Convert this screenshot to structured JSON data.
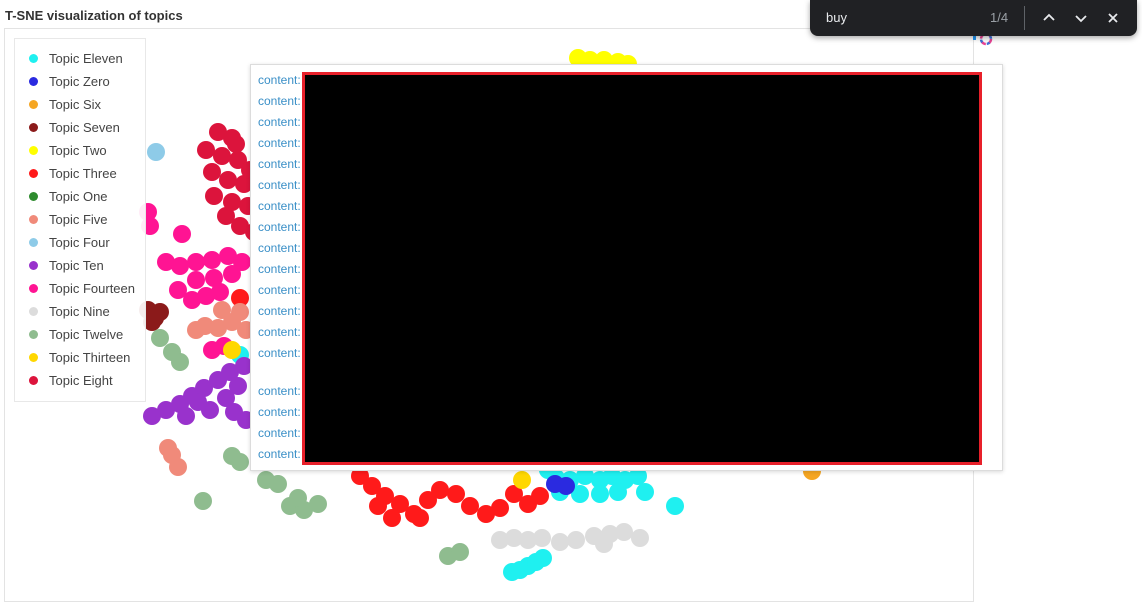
{
  "chart_data": {
    "type": "scatter",
    "title": "T-SNE visualization of topics",
    "legend_position": "top-left",
    "series": [
      {
        "name": "Topic Eleven",
        "color": "#1ff0f0",
        "points": [
          [
            512,
            572
          ],
          [
            520,
            570
          ],
          [
            528,
            566
          ],
          [
            536,
            562
          ],
          [
            543,
            558
          ],
          [
            548,
            470
          ],
          [
            556,
            478
          ],
          [
            570,
            480
          ],
          [
            585,
            476
          ],
          [
            600,
            480
          ],
          [
            612,
            476
          ],
          [
            625,
            480
          ],
          [
            638,
            476
          ],
          [
            645,
            492
          ],
          [
            618,
            492
          ],
          [
            600,
            494
          ],
          [
            580,
            494
          ],
          [
            560,
            492
          ],
          [
            675,
            506
          ],
          [
            240,
            355
          ]
        ]
      },
      {
        "name": "Topic Zero",
        "color": "#2a2ae0",
        "points": [
          [
            555,
            484
          ],
          [
            566,
            486
          ]
        ]
      },
      {
        "name": "Topic Six",
        "color": "#f5a623",
        "points": [
          [
            812,
            471
          ]
        ]
      },
      {
        "name": "Topic Seven",
        "color": "#8b1a1a",
        "points": [
          [
            148,
            310
          ],
          [
            155,
            318
          ],
          [
            160,
            312
          ],
          [
            152,
            322
          ]
        ]
      },
      {
        "name": "Topic Two",
        "color": "#ffff00",
        "points": [
          [
            578,
            58
          ],
          [
            590,
            60
          ],
          [
            604,
            60
          ],
          [
            618,
            62
          ],
          [
            628,
            64
          ]
        ]
      },
      {
        "name": "Topic Three",
        "color": "#ff1a1a",
        "points": [
          [
            360,
            476
          ],
          [
            372,
            486
          ],
          [
            385,
            496
          ],
          [
            400,
            504
          ],
          [
            414,
            514
          ],
          [
            428,
            500
          ],
          [
            440,
            490
          ],
          [
            456,
            494
          ],
          [
            470,
            506
          ],
          [
            486,
            514
          ],
          [
            500,
            508
          ],
          [
            514,
            494
          ],
          [
            528,
            504
          ],
          [
            540,
            496
          ],
          [
            378,
            506
          ],
          [
            392,
            518
          ],
          [
            420,
            518
          ],
          [
            240,
            298
          ]
        ]
      },
      {
        "name": "Topic One",
        "color": "#2e8b2e",
        "points": []
      },
      {
        "name": "Topic Five",
        "color": "#f08a7a",
        "points": [
          [
            178,
            467
          ],
          [
            172,
            455
          ],
          [
            168,
            448
          ],
          [
            205,
            326
          ],
          [
            218,
            328
          ],
          [
            232,
            322
          ],
          [
            240,
            312
          ],
          [
            246,
            330
          ],
          [
            222,
            310
          ],
          [
            196,
            330
          ]
        ]
      },
      {
        "name": "Topic Four",
        "color": "#8ecbe8",
        "points": [
          [
            156,
            152
          ]
        ]
      },
      {
        "name": "Topic Ten",
        "color": "#9932cc",
        "points": [
          [
            152,
            416
          ],
          [
            166,
            410
          ],
          [
            180,
            404
          ],
          [
            192,
            396
          ],
          [
            204,
            388
          ],
          [
            218,
            380
          ],
          [
            230,
            372
          ],
          [
            244,
            366
          ],
          [
            238,
            386
          ],
          [
            226,
            398
          ],
          [
            234,
            412
          ],
          [
            246,
            420
          ],
          [
            210,
            410
          ],
          [
            198,
            402
          ],
          [
            186,
            416
          ]
        ]
      },
      {
        "name": "Topic Fourteen",
        "color": "#ff1493",
        "points": [
          [
            148,
            212
          ],
          [
            150,
            226
          ],
          [
            182,
            234
          ],
          [
            166,
            262
          ],
          [
            180,
            266
          ],
          [
            196,
            262
          ],
          [
            212,
            260
          ],
          [
            228,
            256
          ],
          [
            242,
            262
          ],
          [
            232,
            274
          ],
          [
            214,
            278
          ],
          [
            196,
            280
          ],
          [
            178,
            290
          ],
          [
            192,
            300
          ],
          [
            206,
            296
          ],
          [
            220,
            292
          ],
          [
            212,
            350
          ],
          [
            224,
            346
          ]
        ]
      },
      {
        "name": "Topic Nine",
        "color": "#dcdcdc",
        "points": [
          [
            500,
            540
          ],
          [
            514,
            538
          ],
          [
            528,
            540
          ],
          [
            542,
            538
          ],
          [
            560,
            542
          ],
          [
            576,
            540
          ],
          [
            594,
            536
          ],
          [
            610,
            534
          ],
          [
            624,
            532
          ],
          [
            640,
            538
          ],
          [
            604,
            544
          ]
        ]
      },
      {
        "name": "Topic Twelve",
        "color": "#8fbc8f",
        "points": [
          [
            160,
            338
          ],
          [
            172,
            352
          ],
          [
            180,
            362
          ],
          [
            232,
            456
          ],
          [
            240,
            462
          ],
          [
            266,
            480
          ],
          [
            278,
            484
          ],
          [
            290,
            506
          ],
          [
            304,
            510
          ],
          [
            318,
            504
          ],
          [
            298,
            498
          ],
          [
            203,
            501
          ],
          [
            448,
            556
          ],
          [
            460,
            552
          ]
        ]
      },
      {
        "name": "Topic Thirteen",
        "color": "#ffd700",
        "points": [
          [
            522,
            480
          ],
          [
            232,
            350
          ]
        ]
      },
      {
        "name": "Topic Eight",
        "color": "#dc143c",
        "points": [
          [
            218,
            132
          ],
          [
            232,
            138
          ],
          [
            206,
            150
          ],
          [
            222,
            156
          ],
          [
            238,
            160
          ],
          [
            212,
            172
          ],
          [
            228,
            180
          ],
          [
            244,
            184
          ],
          [
            214,
            196
          ],
          [
            232,
            202
          ],
          [
            248,
            206
          ],
          [
            226,
            216
          ],
          [
            240,
            226
          ],
          [
            254,
            232
          ],
          [
            236,
            144
          ],
          [
            250,
            170
          ]
        ]
      }
    ]
  },
  "tooltip": {
    "rows": [
      "content:",
      "content:",
      "content:",
      "content:",
      "content:",
      "content:",
      "content:",
      "content:",
      "content:",
      "content:",
      "content:",
      "content:",
      "content:",
      "content:",
      "content:",
      "content:",
      "content:",
      "content:"
    ]
  },
  "find_bar": {
    "query": "buy",
    "count": "1/4"
  }
}
